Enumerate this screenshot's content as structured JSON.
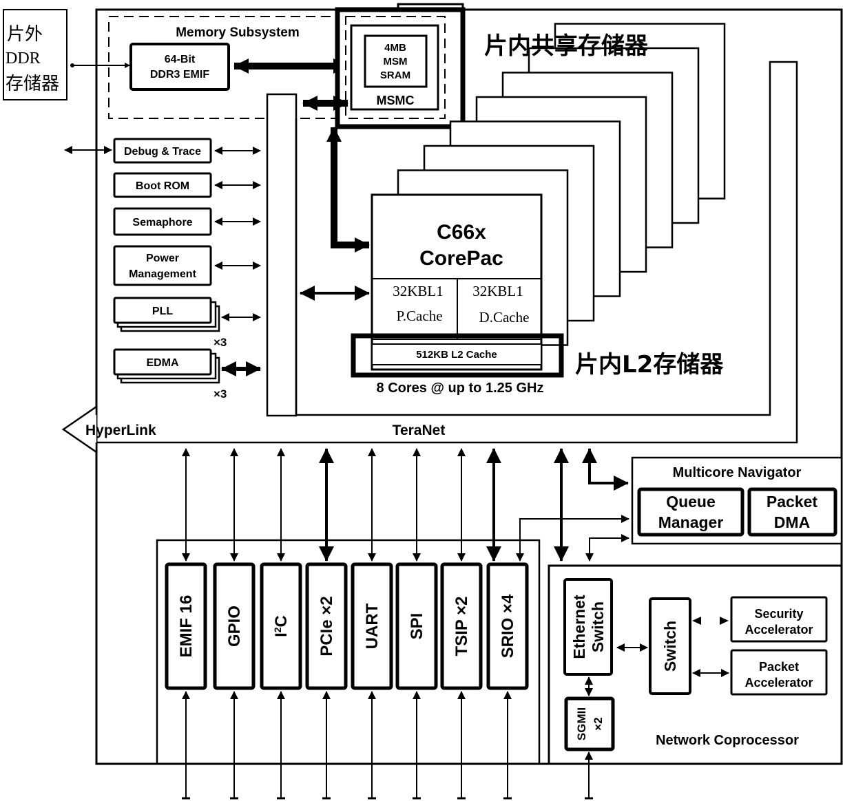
{
  "diagram": {
    "external_ddr": {
      "line1": "片外",
      "line2": "DDR",
      "line3": "存储器"
    },
    "memory_subsystem": {
      "title": "Memory Subsystem",
      "emif": {
        "line1": "64-Bit",
        "line2": "DDR3 EMIF"
      },
      "msm_sram": {
        "line1": "4MB",
        "line2": "MSM",
        "line3": "SRAM"
      },
      "msmc": "MSMC"
    },
    "annotations": {
      "shared_memory": "片内共享存储器",
      "l2_memory": "片内L2存储器"
    },
    "left_blocks": [
      {
        "label": "Debug & Trace"
      },
      {
        "label": "Boot ROM"
      },
      {
        "label": "Semaphore"
      },
      {
        "label": "Power",
        "label2": "Management"
      },
      {
        "label": "PLL",
        "multiplier": "×3"
      },
      {
        "label": "EDMA",
        "multiplier": "×3"
      }
    ],
    "corepac": {
      "title1": "C66x",
      "title2": "CorePac",
      "l1p": {
        "line1": "32KBL1",
        "line2": "P.Cache"
      },
      "l1d": {
        "line1": "32KBL1",
        "line2": "D.Cache"
      },
      "l2": "512KB L2 Cache",
      "caption": "8 Cores @ up to 1.25 GHz",
      "core_count": 8
    },
    "bus": {
      "hyperlink": "HyperLink",
      "teranet": "TeraNet"
    },
    "multicore_navigator": {
      "title": "Multicore Navigator",
      "queue_manager": {
        "line1": "Queue",
        "line2": "Manager"
      },
      "packet_dma": {
        "line1": "Packet",
        "line2": "DMA"
      }
    },
    "peripherals": [
      {
        "label": "EMIF 16"
      },
      {
        "label": "GPIO"
      },
      {
        "label": "I",
        "sup": "2",
        "label_tail": "C"
      },
      {
        "label": "PCIe  ×2"
      },
      {
        "label": "UART"
      },
      {
        "label": "SPI"
      },
      {
        "label": "TSIP  ×2"
      },
      {
        "label": "SRIO  ×4"
      }
    ],
    "network_coprocessor": {
      "title": "Network Coprocessor",
      "ethernet_switch": {
        "line1": "Ethernet",
        "line2": "Switch"
      },
      "sgmii": {
        "line1": "SGMII",
        "line2": "×2"
      },
      "switch": "Switch",
      "security_accelerator": {
        "line1": "Security",
        "line2": "Accelerator"
      },
      "packet_accelerator": {
        "line1": "Packet",
        "line2": "Accelerator"
      }
    }
  }
}
